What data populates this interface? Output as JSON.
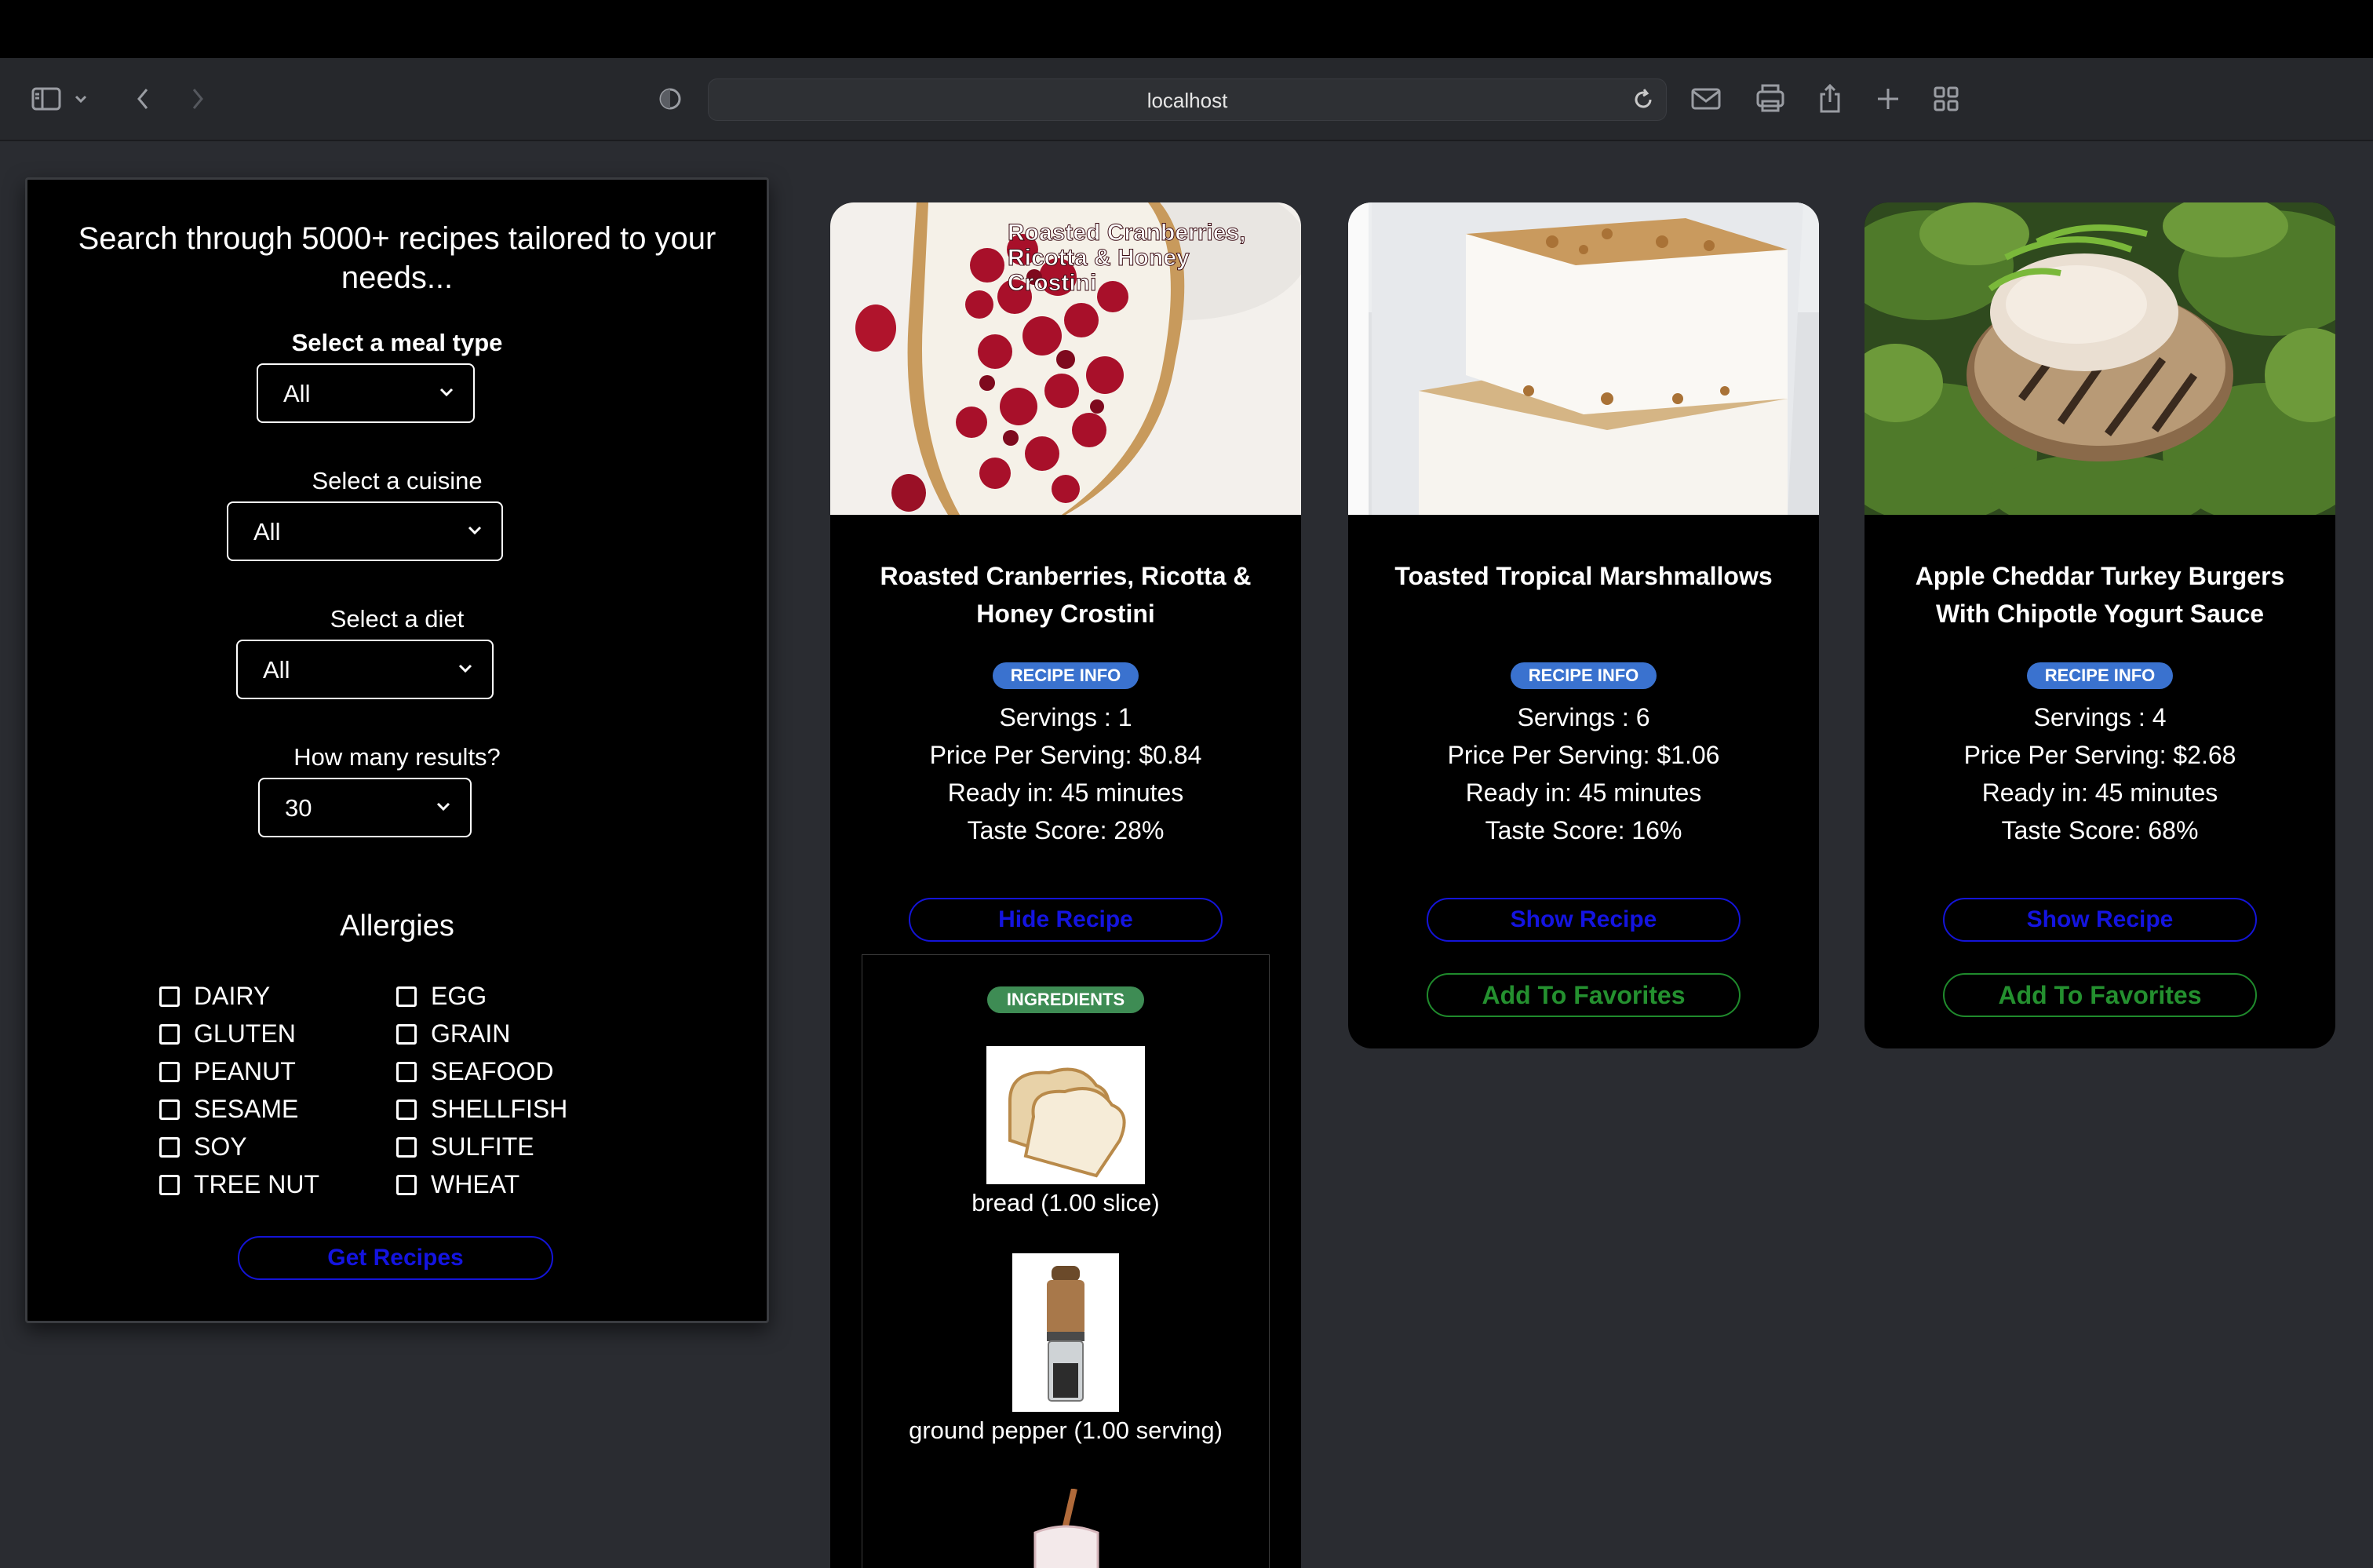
{
  "browser": {
    "url": "localhost"
  },
  "search": {
    "title": "Search through 5000+ recipes tailored to your needs...",
    "meal_type_label": "Select a meal type",
    "meal_type_value": "All",
    "cuisine_label": "Select a cuisine",
    "cuisine_value": "All",
    "diet_label": "Select a diet",
    "diet_value": "All",
    "results_label": "How many results?",
    "results_value": "30",
    "allergies_title": "Allergies",
    "allergies": [
      "DAIRY",
      "EGG",
      "GLUTEN",
      "GRAIN",
      "PEANUT",
      "SEAFOOD",
      "SESAME",
      "SHELLFISH",
      "SOY",
      "SULFITE",
      "TREE NUT",
      "WHEAT"
    ],
    "submit_label": "Get Recipes"
  },
  "recipes": [
    {
      "title": "Roasted Cranberries, Ricotta & Honey Crostini",
      "image_caption": "Roasted Cranberries, Ricotta & Honey Crostini",
      "badge": "RECIPE INFO",
      "servings": "Servings : 1",
      "price": "Price Per Serving: $0.84",
      "ready": "Ready in: 45 minutes",
      "taste": "Taste Score: 28%",
      "toggle_label": "Hide Recipe",
      "ingredients_badge": "INGREDIENTS",
      "ingredients": [
        "bread (1.00 slice)",
        "ground pepper (1.00 serving)"
      ]
    },
    {
      "title": "Toasted Tropical Marshmallows",
      "badge": "RECIPE INFO",
      "servings": "Servings : 6",
      "price": "Price Per Serving: $1.06",
      "ready": "Ready in: 45 minutes",
      "taste": "Taste Score: 16%",
      "toggle_label": "Show Recipe",
      "favorite_label": "Add To Favorites"
    },
    {
      "title": "Apple Cheddar Turkey Burgers With Chipotle Yogurt Sauce",
      "badge": "RECIPE INFO",
      "servings": "Servings : 4",
      "price": "Price Per Serving: $2.68",
      "ready": "Ready in: 45 minutes",
      "taste": "Taste Score: 68%",
      "toggle_label": "Show Recipe",
      "favorite_label": "Add To Favorites"
    }
  ],
  "colors": {
    "button_blue": "#1414e0",
    "button_green": "#24902f",
    "badge_blue": "#3a72cf",
    "badge_green": "#3e8c54"
  }
}
